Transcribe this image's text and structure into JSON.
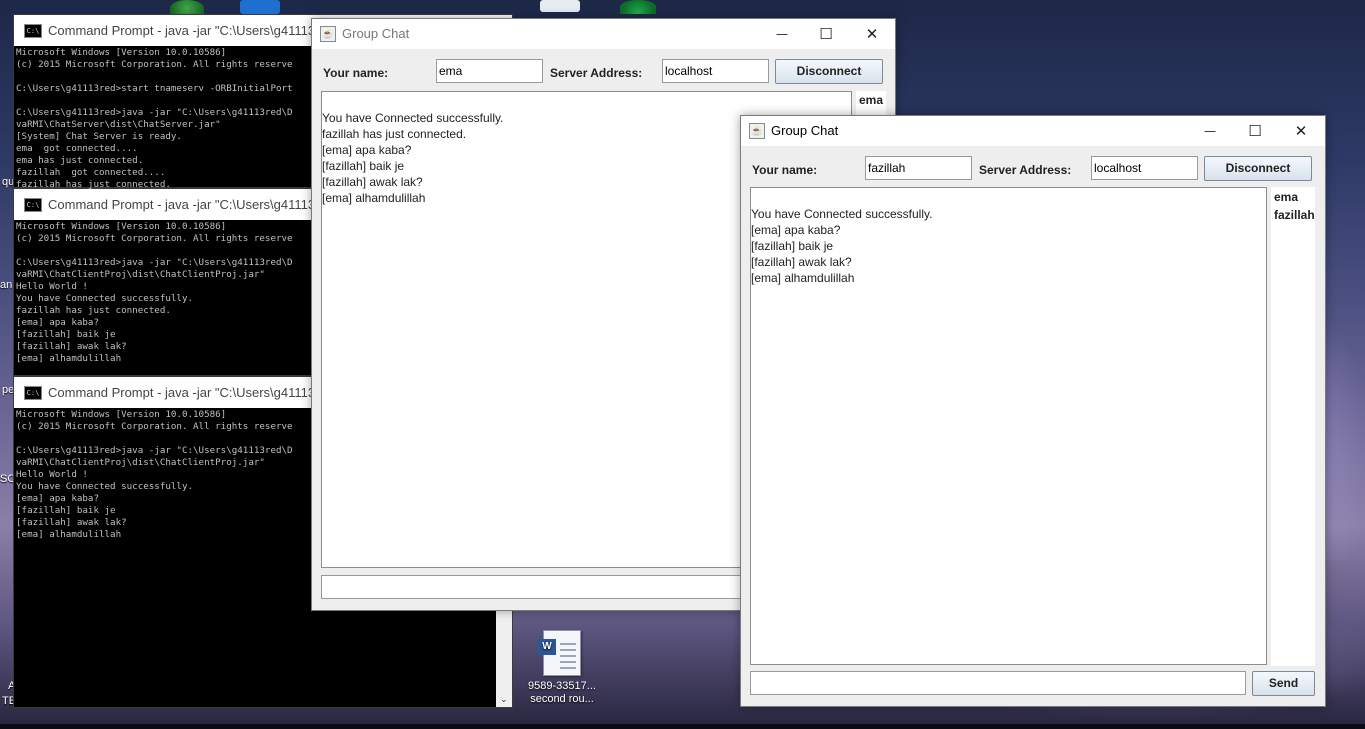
{
  "desktop": {
    "icon_doc": {
      "line1": "9589-33517...",
      "line2": "second rou..."
    },
    "fragments": {
      "a": "an",
      "b": "pe",
      "c": "SC",
      "d": "qu",
      "e": "A",
      "f": "TE"
    }
  },
  "console_server": {
    "title": "Command Prompt - java  -jar \"C:\\Users\\g41113red",
    "lines": [
      "Microsoft Windows [Version 10.0.10586]",
      "(c) 2015 Microsoft Corporation. All rights reserve",
      "",
      "C:\\Users\\g41113red>start tnameserv -ORBInitialPort",
      "",
      "C:\\Users\\g41113red>java -jar \"C:\\Users\\g41113red\\D",
      "vaRMI\\ChatServer\\dist\\ChatServer.jar\"",
      "[System] Chat Server is ready.",
      "ema  got connected....",
      "ema has just connected.",
      "fazillah  got connected....",
      "fazillah has just connected."
    ]
  },
  "console_client1": {
    "title": "Command Prompt - java  -jar \"C:\\Users\\g41113red",
    "lines": [
      "Microsoft Windows [Version 10.0.10586]",
      "(c) 2015 Microsoft Corporation. All rights reserve",
      "",
      "C:\\Users\\g41113red>java -jar \"C:\\Users\\g41113red\\D",
      "vaRMI\\ChatClientProj\\dist\\ChatClientProj.jar\"",
      "Hello World !",
      "You have Connected successfully.",
      "fazillah has just connected.",
      "[ema] apa kaba?",
      "[fazillah] baik je",
      "[fazillah] awak lak?",
      "[ema] alhamdulillah"
    ]
  },
  "console_client2": {
    "title": "Command Prompt - java  -jar \"C:\\Users\\g41113red",
    "lines": [
      "Microsoft Windows [Version 10.0.10586]",
      "(c) 2015 Microsoft Corporation. All rights reserve",
      "",
      "C:\\Users\\g41113red>java -jar \"C:\\Users\\g41113red\\D",
      "vaRMI\\ChatClientProj\\dist\\ChatClientProj.jar\"",
      "Hello World !",
      "You have Connected successfully.",
      "[ema] apa kaba?",
      "[fazillah] baik je",
      "[fazillah] awak lak?",
      "[ema] alhamdulillah"
    ],
    "scroll_arrow": "⌄"
  },
  "chat_ema": {
    "title": "Group Chat",
    "name_label": "Your name:",
    "name_value": "ema",
    "server_label": "Server Address:",
    "server_value": "localhost",
    "disconnect_label": "Disconnect",
    "messages": [
      "You have Connected successfully.",
      "fazillah has just connected.",
      "[ema] apa kaba?",
      "[fazillah] baik je",
      "[fazillah] awak lak?",
      "[ema] alhamdulillah"
    ],
    "users": [
      "ema"
    ]
  },
  "chat_fazillah": {
    "title": "Group Chat",
    "name_label": "Your name:",
    "name_value": "fazillah",
    "server_label": "Server Address:",
    "server_value": "localhost",
    "disconnect_label": "Disconnect",
    "messages": [
      "You have Connected successfully.",
      "[ema] apa kaba?",
      "[fazillah] baik je",
      "[fazillah] awak lak?",
      "[ema] alhamdulillah"
    ],
    "users": [
      "ema",
      "fazillah"
    ],
    "send_label": "Send",
    "message_input": ""
  },
  "window_controls": {
    "minimize": "—",
    "maximize": "☐",
    "close": "✕"
  }
}
